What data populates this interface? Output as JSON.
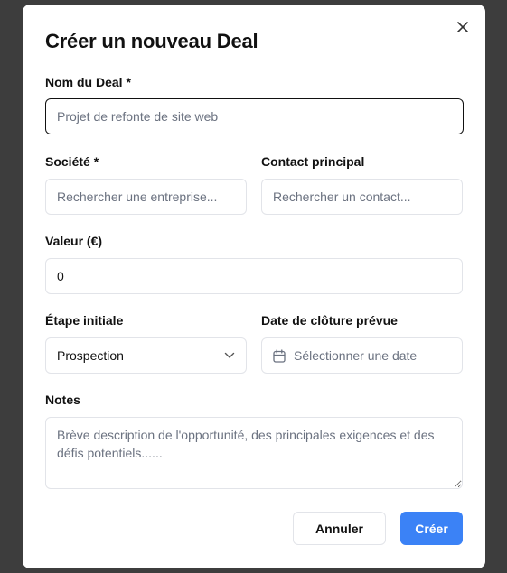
{
  "dialog": {
    "title": "Créer un nouveau Deal",
    "close_icon": "close-icon"
  },
  "fields": {
    "deal_name": {
      "label": "Nom du Deal *",
      "placeholder": "Projet de refonte de site web",
      "value": ""
    },
    "company": {
      "label": "Société *",
      "placeholder": "Rechercher une entreprise...",
      "value": ""
    },
    "contact": {
      "label": "Contact principal",
      "placeholder": "Rechercher un contact...",
      "value": ""
    },
    "value": {
      "label": "Valeur (€)",
      "value": "0"
    },
    "stage": {
      "label": "Étape initiale",
      "selected": "Prospection",
      "icon": "chevron-down-icon"
    },
    "close_date": {
      "label": "Date de clôture prévue",
      "placeholder": "Sélectionner une date",
      "icon": "calendar-icon"
    },
    "notes": {
      "label": "Notes",
      "placeholder": "Brève description de l'opportunité, des principales exigences et des défis potentiels......",
      "value": ""
    }
  },
  "actions": {
    "cancel_label": "Annuler",
    "create_label": "Créer"
  },
  "colors": {
    "primary": "#3b82f6",
    "overlay": "#3d3d3d",
    "border": "#e2e4e9",
    "focus_border": "#111111"
  }
}
